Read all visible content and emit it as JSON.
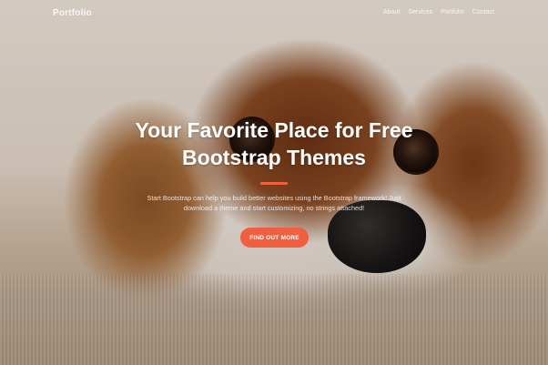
{
  "navbar": {
    "brand": "Portfolio",
    "links": [
      "About",
      "Services",
      "Portfolio",
      "Contact"
    ]
  },
  "hero": {
    "headline_line1": "Your Favorite Place for Free",
    "headline_line2": "Bootstrap Themes",
    "lead_line1": "Start Bootstrap can help you build better websites using the Bootstrap framework! Just",
    "lead_line2": "download a theme and start customizing, no strings attached!",
    "cta_label": "FIND OUT MORE"
  },
  "colors": {
    "accent": "#f05f40"
  }
}
